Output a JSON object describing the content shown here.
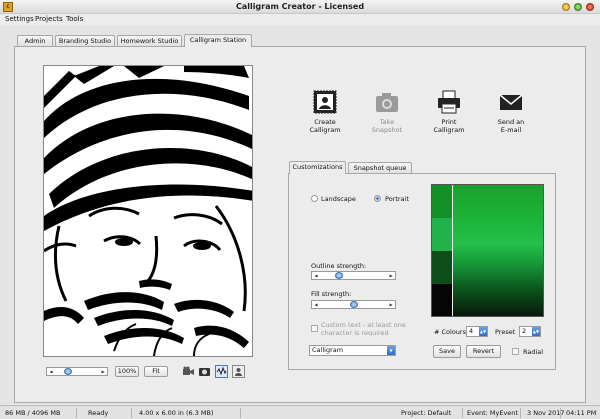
{
  "window": {
    "title": "Calligram Creator - Licensed",
    "app_icon_text": "C"
  },
  "menu": [
    "Settings",
    "Projects",
    "Tools"
  ],
  "tabs": [
    {
      "label": "Admin",
      "active": false
    },
    {
      "label": "Branding Studio",
      "active": false
    },
    {
      "label": "Homework Studio",
      "active": false
    },
    {
      "label": "Calligram Station",
      "active": true
    }
  ],
  "zoom": {
    "value_label": "100%",
    "fit_label": "Fit",
    "slider_fraction": 0.3
  },
  "tools": [
    {
      "icon": "video-camera-icon"
    },
    {
      "icon": "camera-icon"
    },
    {
      "icon": "waveform-icon"
    },
    {
      "icon": "portrait-icon"
    }
  ],
  "actions": [
    {
      "label": "Create\nCalligram",
      "icon": "calligram-frame-icon",
      "enabled": true
    },
    {
      "label": "Take\nSnapshot",
      "icon": "camera-icon",
      "enabled": false
    },
    {
      "label": "Print\nCalligram",
      "icon": "printer-icon",
      "enabled": true
    },
    {
      "label": "Send an\nE-mail",
      "icon": "envelope-icon",
      "enabled": true
    }
  ],
  "subtabs": [
    {
      "label": "Customizations",
      "active": true
    },
    {
      "label": "Snapshot queue",
      "active": false
    }
  ],
  "customizations": {
    "orientation": {
      "landscape_label": "Landscape",
      "portrait_label": "Portrait",
      "selected": "Portrait"
    },
    "outline_label": "Outline strength:",
    "outline_fraction": 0.3,
    "fill_label": "Fill strength:",
    "fill_fraction": 0.5,
    "custom_text_label": "Custom text - at least one\ncharacter is required",
    "custom_text_checked": false,
    "style_selected": "Calligram"
  },
  "colours": {
    "colours_label": "# Colours",
    "colours_value": "4",
    "preset_label": "Preset",
    "preset_value": "2",
    "save_label": "Save",
    "revert_label": "Revert",
    "radial_label": "Radial",
    "radial_checked": false,
    "swatches": [
      "#139128",
      "#21b24a",
      "#0b4e1a",
      "#050505"
    ],
    "gradient_line_color": "#f0f0f0"
  },
  "status": {
    "memory": "86 MB / 4096 MB",
    "state": "Ready",
    "size": "4.00 x 6.00 in (6.3 MB)",
    "project": "Project: Default",
    "event": "Event: MyEvent",
    "date": "3 Nov 2017",
    "time": "04:11 PM"
  }
}
